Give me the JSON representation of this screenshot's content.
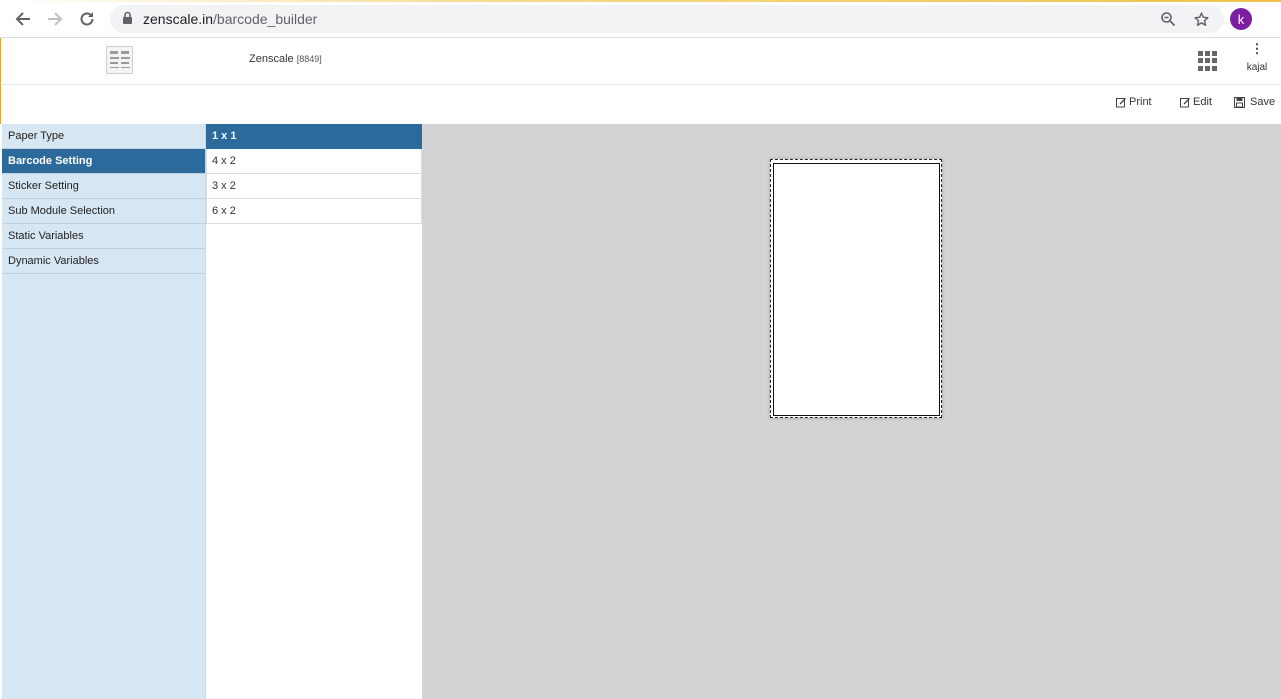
{
  "browser": {
    "url_domain": "zenscale.in",
    "url_path": "/barcode_builder",
    "avatar_letter": "k",
    "icons": [
      "back-icon",
      "forward-icon",
      "reload-icon",
      "lock-icon",
      "zoom-icon",
      "star-icon"
    ]
  },
  "header": {
    "company_name": "Zenscale",
    "company_id": "[8849]",
    "user_name": "kajal",
    "kebab": "⋮"
  },
  "toolbar": {
    "print_label": "Print",
    "edit_label": "Edit",
    "save_label": "Save"
  },
  "left_menu": {
    "items": [
      {
        "label": "Paper Type",
        "active": false
      },
      {
        "label": "Barcode Setting",
        "active": true
      },
      {
        "label": "Sticker Setting",
        "active": false
      },
      {
        "label": "Sub Module Selection",
        "active": false
      },
      {
        "label": "Static Variables",
        "active": false
      },
      {
        "label": "Dynamic Variables",
        "active": false
      }
    ]
  },
  "sizes": {
    "items": [
      {
        "label": "1 x 1",
        "active": true
      },
      {
        "label": "4 x 2",
        "active": false
      },
      {
        "label": "3 x 2",
        "active": false
      },
      {
        "label": "6 x 2",
        "active": false
      }
    ]
  },
  "colors": {
    "active_blue": "#2d6a9c",
    "menu_bg": "#d6e6f2",
    "canvas_bg": "#d3d3d3",
    "avatar_purple": "#7b1fa2"
  }
}
